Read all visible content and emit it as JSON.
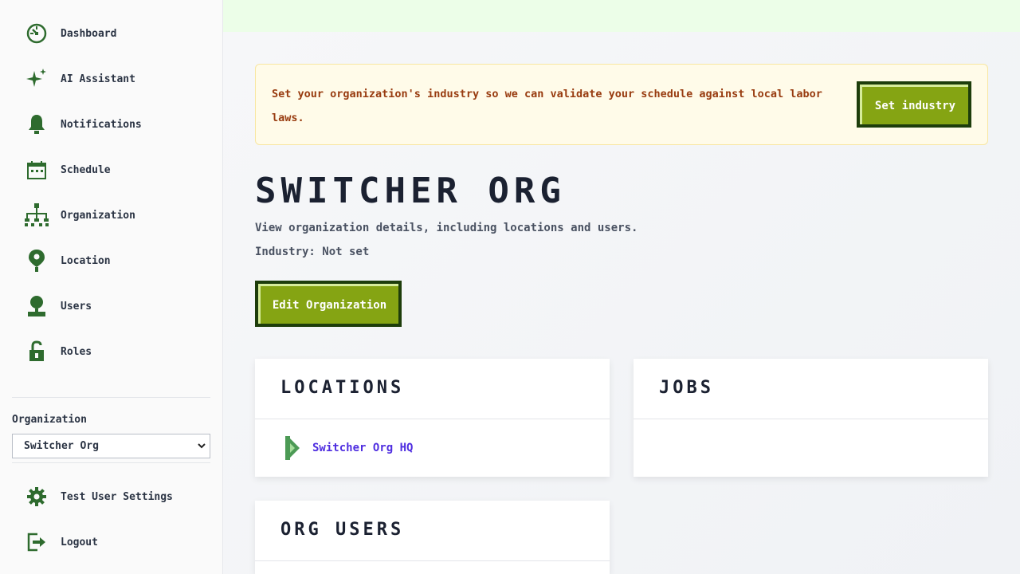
{
  "sidebar": {
    "items": [
      {
        "label": "Dashboard",
        "icon": "dashboard-icon"
      },
      {
        "label": "AI Assistant",
        "icon": "sparkle-icon"
      },
      {
        "label": "Notifications",
        "icon": "bell-icon"
      },
      {
        "label": "Schedule",
        "icon": "calendar-icon"
      },
      {
        "label": "Organization",
        "icon": "org-chart-icon"
      },
      {
        "label": "Location",
        "icon": "map-pin-icon"
      },
      {
        "label": "Users",
        "icon": "user-icon"
      },
      {
        "label": "Roles",
        "icon": "lock-icon"
      }
    ],
    "org_label": "Organization",
    "org_select": {
      "selected": "Switcher Org"
    },
    "bottom": [
      {
        "label": "Test User Settings",
        "icon": "gear-icon"
      },
      {
        "label": "Logout",
        "icon": "logout-icon"
      }
    ]
  },
  "banner": {
    "text": "Set your organization's industry so we can validate your schedule against local labor laws.",
    "button": "Set industry"
  },
  "page": {
    "title": "SWITCHER ORG",
    "description": "View organization details, including locations and users.",
    "industry": "Industry: Not set",
    "edit_button": "Edit Organization"
  },
  "cards": {
    "locations": {
      "title": "LOCATIONS",
      "items": [
        "Switcher Org HQ"
      ]
    },
    "jobs": {
      "title": "JOBS"
    },
    "org_users": {
      "title": "ORG USERS"
    }
  },
  "colors": {
    "accent_green": "#85a413",
    "dark_green": "#1d3d0b",
    "icon_green": "#2e6b2e",
    "link_purple": "#4f2ee0",
    "banner_text": "#983b0f"
  }
}
